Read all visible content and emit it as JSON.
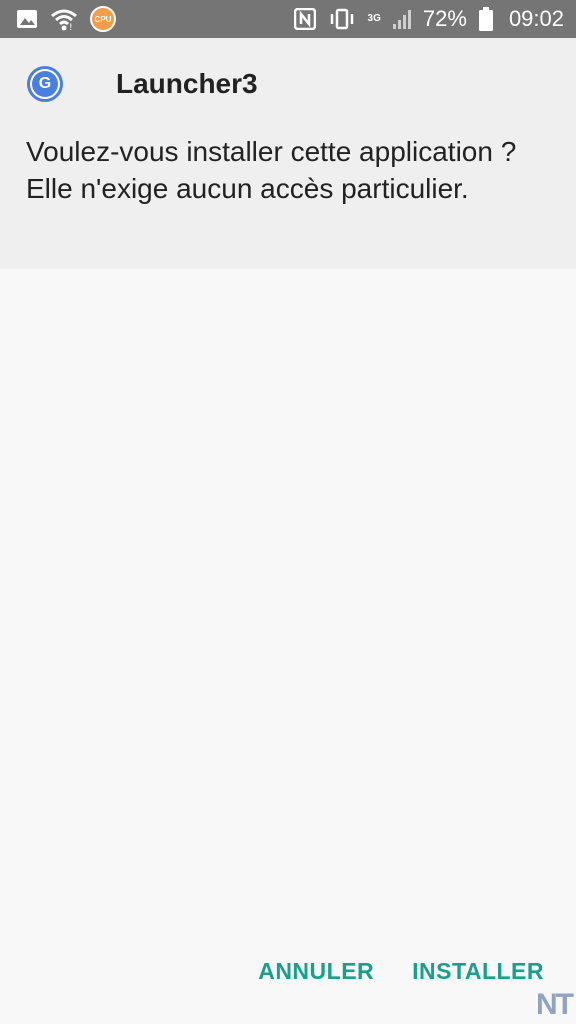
{
  "status_bar": {
    "icons_left": [
      "image-icon",
      "wifi-icon",
      "cpu-icon"
    ],
    "cpu_label": "CPU",
    "icons_right": [
      "nfc-icon",
      "vibrate-icon",
      "network-3g-icon",
      "signal-icon",
      "battery-icon"
    ],
    "network_type": "3G",
    "battery": "72%",
    "time": "09:02"
  },
  "dialog": {
    "app_icon": "google-g-icon",
    "app_icon_letter": "G",
    "app_name": "Launcher3",
    "message": "Voulez-vous installer cette application ? Elle n'exige aucun accès particulier."
  },
  "actions": {
    "cancel_label": "ANNULER",
    "install_label": "INSTALLER"
  },
  "watermark": "NT",
  "colors": {
    "status_bar": "#757575",
    "header_bg": "#efefef",
    "accent": "#18a08a",
    "app_icon": "#4a7fe0"
  }
}
